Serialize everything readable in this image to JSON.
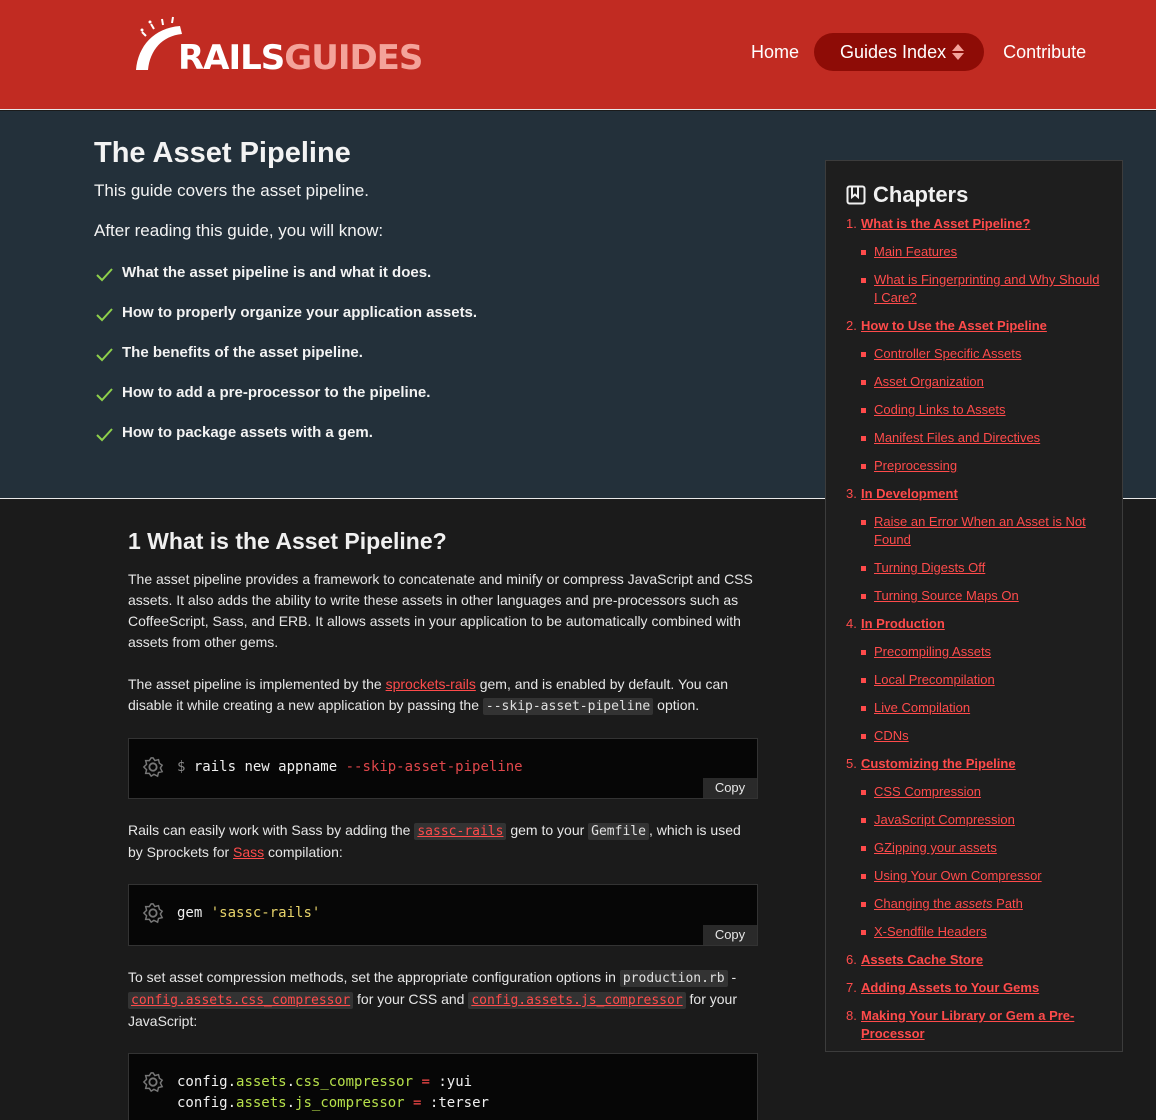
{
  "header": {
    "logo_rails": "RAILS",
    "logo_guides": "GUIDES",
    "nav": {
      "home": "Home",
      "guides_index": "Guides Index",
      "contribute": "Contribute"
    },
    "colors": {
      "header_bg": "#c12b22",
      "pill_bg": "#8e0c06",
      "accent": "#ff4b4b"
    }
  },
  "intro": {
    "title": "The Asset Pipeline",
    "subtitle": "This guide covers the asset pipeline.",
    "after_reading": "After reading this guide, you will know:",
    "outcomes": [
      "What the asset pipeline is and what it does.",
      "How to properly organize your application assets.",
      "The benefits of the asset pipeline.",
      "How to add a pre-processor to the pipeline.",
      "How to package assets with a gem."
    ]
  },
  "chapters": {
    "title": "Chapters",
    "items": [
      {
        "num": "1.",
        "label": "What is the Asset Pipeline?",
        "subs": [
          "Main Features",
          "What is Fingerprinting and Why Should I Care?"
        ]
      },
      {
        "num": "2.",
        "label": "How to Use the Asset Pipeline",
        "subs": [
          "Controller Specific Assets",
          "Asset Organization",
          "Coding Links to Assets",
          "Manifest Files and Directives",
          "Preprocessing"
        ]
      },
      {
        "num": "3.",
        "label": "In Development",
        "subs": [
          "Raise an Error When an Asset is Not Found",
          "Turning Digests Off",
          "Turning Source Maps On"
        ]
      },
      {
        "num": "4.",
        "label": "In Production",
        "subs": [
          "Precompiling Assets",
          "Local Precompilation",
          "Live Compilation",
          "CDNs"
        ]
      },
      {
        "num": "5.",
        "label": "Customizing the Pipeline",
        "subs": [
          "CSS Compression",
          "JavaScript Compression",
          "GZipping your assets",
          "Using Your Own Compressor",
          "Changing the assets Path",
          "X-Sendfile Headers"
        ]
      },
      {
        "num": "6.",
        "label": "Assets Cache Store",
        "subs": []
      },
      {
        "num": "7.",
        "label": "Adding Assets to Your Gems",
        "subs": []
      },
      {
        "num": "8.",
        "label": "Making Your Library or Gem a Pre-Processor",
        "subs": []
      }
    ]
  },
  "main": {
    "section_title": "1 What is the Asset Pipeline?",
    "p1": "The asset pipeline provides a framework to concatenate and minify or compress JavaScript and CSS assets. It also adds the ability to write these assets in other languages and pre-processors such as CoffeeScript, Sass, and ERB. It allows assets in your application to be automatically combined with assets from other gems.",
    "p2": {
      "a": "The asset pipeline is implemented by the ",
      "link": "sprockets-rails",
      "b": " gem, and is enabled by default. You can disable it while creating a new application by passing the ",
      "code": "--skip-asset-pipeline",
      "c": " option."
    },
    "code1": {
      "prompt": "$",
      "cmd": "rails new appname",
      "opt": "--skip-asset-pipeline"
    },
    "p3": {
      "a": "Rails can easily work with Sass by adding the ",
      "code_link": "sassc-rails",
      "b": " gem to your ",
      "code": "Gemfile",
      "c": ", which is used by Sprockets for ",
      "link": "Sass",
      "d": " compilation:"
    },
    "code2": {
      "kw": "gem",
      "str": "'sassc-rails'"
    },
    "p4": {
      "a": "To set asset compression methods, set the appropriate configuration options in ",
      "code": "production.rb",
      "b": " - ",
      "code_link1": "config.assets.css_compressor",
      "c": " for your CSS and ",
      "code_link2": "config.assets.js_compressor",
      "d": " for your JavaScript:"
    },
    "code3": {
      "line1": {
        "obj": "config",
        "dot1": ".",
        "m1": "assets",
        "dot2": ".",
        "m2": "css_compressor",
        "op": "=",
        "val": ":yui"
      },
      "line2": {
        "obj": "config",
        "dot1": ".",
        "m1": "assets",
        "dot2": ".",
        "m2": "js_compressor",
        "op": "=",
        "val": ":terser"
      }
    },
    "copy_label": "Copy"
  }
}
